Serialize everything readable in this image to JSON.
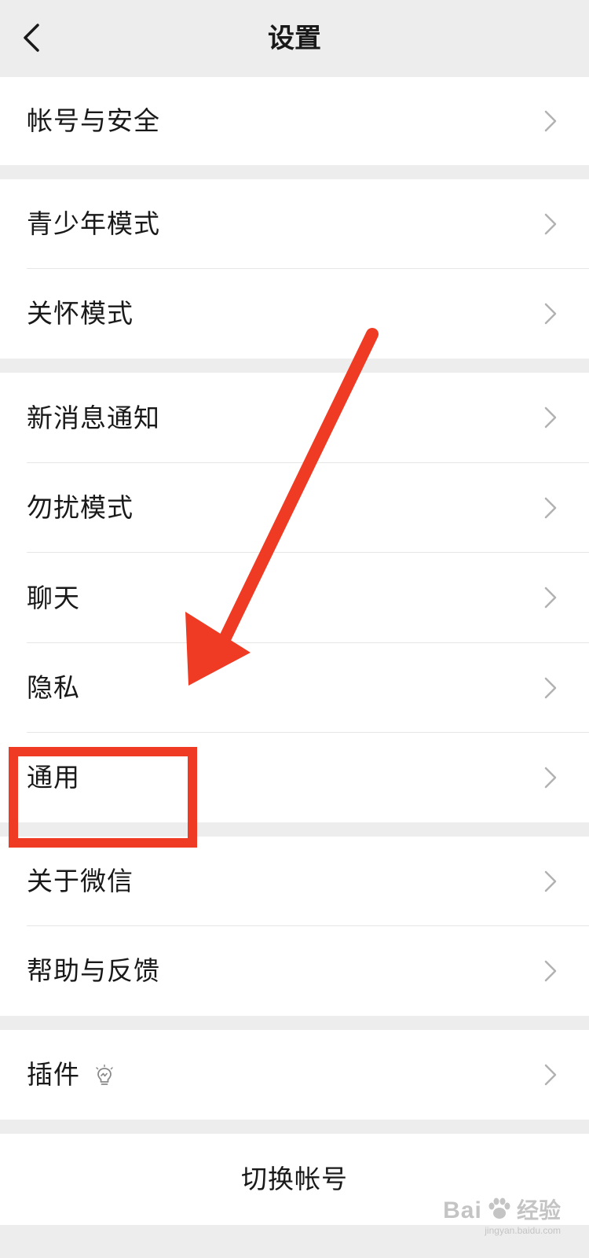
{
  "header": {
    "title": "设置",
    "back_icon": "chevron-left-icon"
  },
  "groups": [
    {
      "items": [
        {
          "label": "帐号与安全"
        }
      ]
    },
    {
      "items": [
        {
          "label": "青少年模式"
        },
        {
          "label": "关怀模式"
        }
      ]
    },
    {
      "items": [
        {
          "label": "新消息通知"
        },
        {
          "label": "勿扰模式"
        },
        {
          "label": "聊天"
        },
        {
          "label": "隐私"
        },
        {
          "label": "通用"
        }
      ]
    },
    {
      "items": [
        {
          "label": "关于微信"
        },
        {
          "label": "帮助与反馈"
        }
      ]
    },
    {
      "items": [
        {
          "label": "插件"
        }
      ]
    }
  ],
  "switch_account": {
    "label": "切换帐号"
  },
  "annotation": {
    "color": "#ef3b24"
  },
  "watermark": {
    "brand": "Bai",
    "sub": "经验",
    "url": "jingyan.baidu.com"
  },
  "colors": {
    "background": "#ededed",
    "row_bg": "#ffffff",
    "text": "#191919",
    "chevron": "#b2b2b2"
  }
}
